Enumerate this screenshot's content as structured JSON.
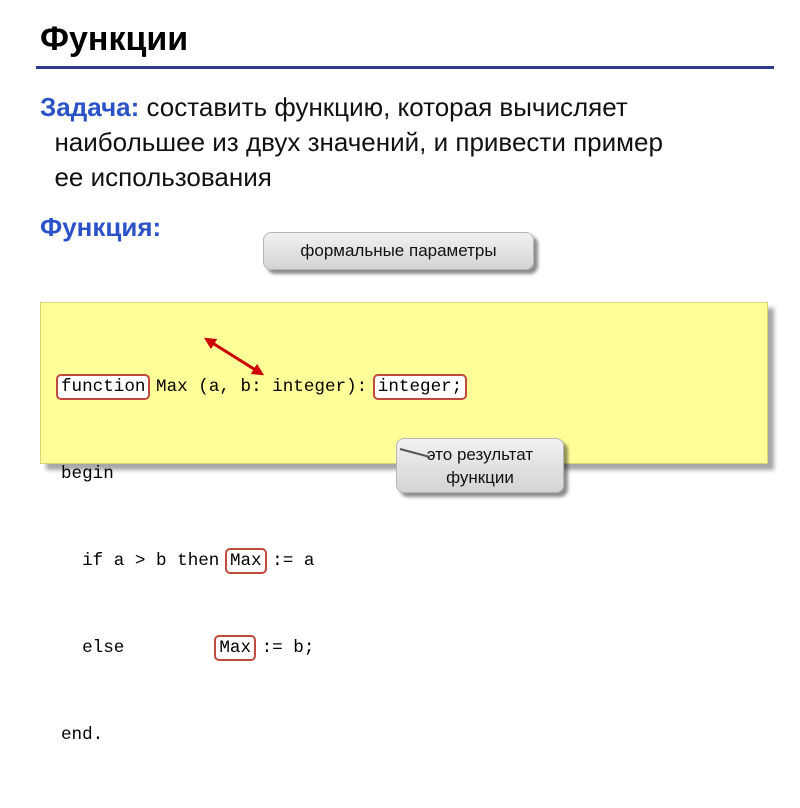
{
  "slide": {
    "title": "Функции",
    "task_label": "Задача:",
    "task_line1": " составить функцию, которая вычисляет",
    "task_line2": "  наибольшее из двух значений, и привести пример",
    "task_line3": "  ее использования",
    "function_label": "Функция:"
  },
  "callouts": {
    "params": "формальные параметры",
    "result_line1": "это результат",
    "result_line2": "функции"
  },
  "code": {
    "l1_kw": "function",
    "l1_name": "Max",
    "l1_params": " (a, b: integer):",
    "l1_type": "integer;",
    "l2": "begin",
    "l3_pre": "  if a > b then ",
    "l3_max": "Max",
    "l3_post": " := a",
    "l4_pre": "  else         ",
    "l4_max": "Max",
    "l4_post": " := b;",
    "l5": "end."
  },
  "colors": {
    "accent_blue": "#2b53c7",
    "highlight_border": "#c24a3a",
    "code_background": "#ffff99",
    "arrow": "#cc0000"
  }
}
